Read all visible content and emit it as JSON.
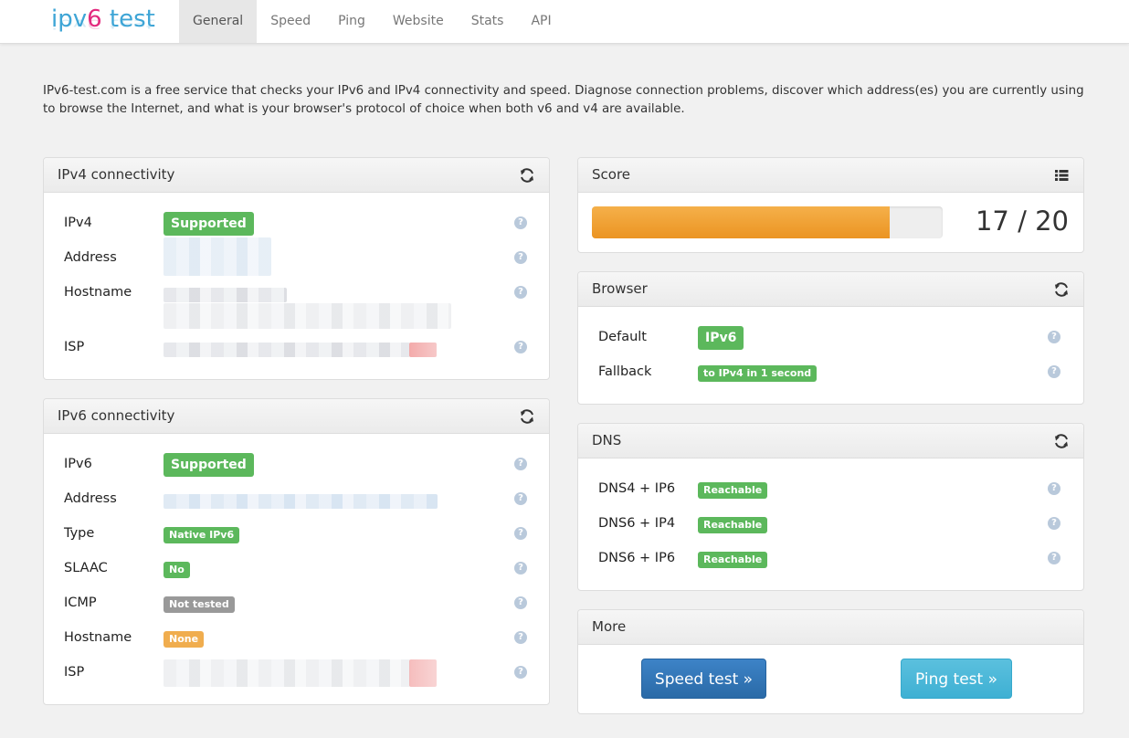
{
  "brand": {
    "part1": "ipv",
    "part2": "6",
    "part3": " test"
  },
  "nav": [
    {
      "label": "General",
      "active": true
    },
    {
      "label": "Speed"
    },
    {
      "label": "Ping"
    },
    {
      "label": "Website"
    },
    {
      "label": "Stats"
    },
    {
      "label": "API"
    }
  ],
  "intro": "IPv6-test.com is a free service that checks your IPv6 and IPv4 connectivity and speed. Diagnose connection problems, discover which address(es) you are currently using to browse the Internet, and what is your browser's protocol of choice when both v6 and v4 are available.",
  "ipv4": {
    "title": "IPv4 connectivity",
    "rows": {
      "ipv4": "IPv4",
      "address": "Address",
      "hostname": "Hostname",
      "isp": "ISP"
    },
    "status": "Supported"
  },
  "ipv6": {
    "title": "IPv6 connectivity",
    "rows": {
      "ipv6": "IPv6",
      "address": "Address",
      "type": "Type",
      "slaac": "SLAAC",
      "icmp": "ICMP",
      "hostname": "Hostname",
      "isp": "ISP"
    },
    "status": "Supported",
    "type_value": "Native IPv6",
    "slaac_value": "No",
    "icmp_value": "Not tested",
    "hostname_value": "None"
  },
  "score": {
    "title": "Score",
    "value": 17,
    "max": 20,
    "text": "17 / 20"
  },
  "browser": {
    "title": "Browser",
    "default_label": "Default",
    "default_value": "IPv6",
    "fallback_label": "Fallback",
    "fallback_value": "to IPv4 in 1 second"
  },
  "dns": {
    "title": "DNS",
    "rows": [
      {
        "label": "DNS4 + IP6",
        "value": "Reachable"
      },
      {
        "label": "DNS6 + IP4",
        "value": "Reachable"
      },
      {
        "label": "DNS6 + IP6",
        "value": "Reachable"
      }
    ]
  },
  "more": {
    "title": "More",
    "speed_button": "Speed test »",
    "ping_button": "Ping test »"
  },
  "help_glyph": "?",
  "colors": {
    "success": "#5cb85c",
    "warning": "#f0ad4e",
    "muted": "#999999",
    "primary": "#2a6aa7",
    "info": "#5bc0de"
  }
}
